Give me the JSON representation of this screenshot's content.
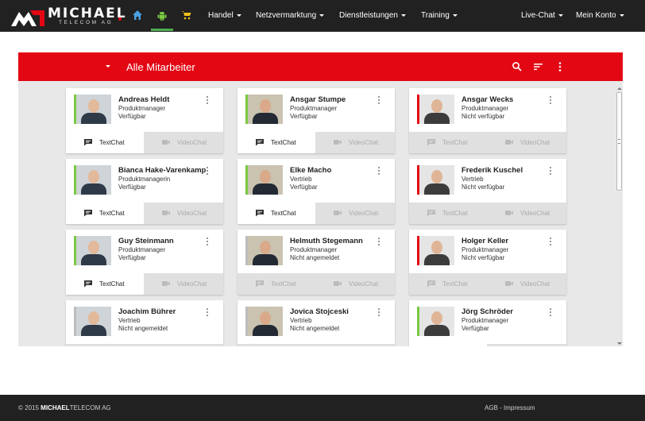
{
  "brand": {
    "name": "MICHAEL",
    "sub": "TELECOM AG"
  },
  "nav": {
    "icons": [
      "home-icon",
      "android-icon",
      "shopping-cart-icon"
    ],
    "menus": [
      "Handel",
      "Netzvermarktung",
      "Dienstleistungen",
      "Training"
    ],
    "right": [
      "Live-Chat",
      "Mein Konto"
    ]
  },
  "panel": {
    "title": "Alle Mitarbeiter"
  },
  "buttons": {
    "textchat": "TextChat",
    "videochat": "VideoChat"
  },
  "colors": {
    "accent": "#e30613",
    "available": "#7ac943",
    "unavailable": "#e30613",
    "offline": "#bdbdbd"
  },
  "employees": [
    {
      "name": "Andreas Heldt",
      "role": "Produktmanager",
      "state": "Verfügbar",
      "status": "available"
    },
    {
      "name": "Ansgar Stumpe",
      "role": "Produktmanager",
      "state": "Verfügbar",
      "status": "available"
    },
    {
      "name": "Ansgar Wecks",
      "role": "Produktmanager",
      "state": "Nicht verfügbar",
      "status": "unavailable"
    },
    {
      "name": "Bianca Hake-Varenkamp",
      "role": "Produktmanagerin",
      "state": "Verfügbar",
      "status": "available"
    },
    {
      "name": "Elke Macho",
      "role": "Vertrieb",
      "state": "Verfügbar",
      "status": "available"
    },
    {
      "name": "Frederik Kuschel",
      "role": "Vertrieb",
      "state": "Nicht verfügbar",
      "status": "unavailable"
    },
    {
      "name": "Guy Steinmann",
      "role": "Produktmanager",
      "state": "Verfügbar",
      "status": "available"
    },
    {
      "name": "Helmuth Stegemann",
      "role": "Produktmanager",
      "state": "Nicht angemeldet",
      "status": "offline"
    },
    {
      "name": "Holger Keller",
      "role": "Produktmanager",
      "state": "Nicht verfügbar",
      "status": "unavailable"
    },
    {
      "name": "Joachim Bührer",
      "role": "Vertrieb",
      "state": "Nicht angemeldet",
      "status": "offline"
    },
    {
      "name": "Jovica Stojceski",
      "role": "Vertrieb",
      "state": "Nicht angemeldet",
      "status": "offline"
    },
    {
      "name": "Jörg Schröder",
      "role": "Produktmanager",
      "state": "Verfügbar",
      "status": "available"
    }
  ],
  "footer": {
    "copy_prefix": "© 2015",
    "company_bold": "MICHAEL",
    "company_rest": "TELECOM AG",
    "links": "AGB - Impressum"
  }
}
